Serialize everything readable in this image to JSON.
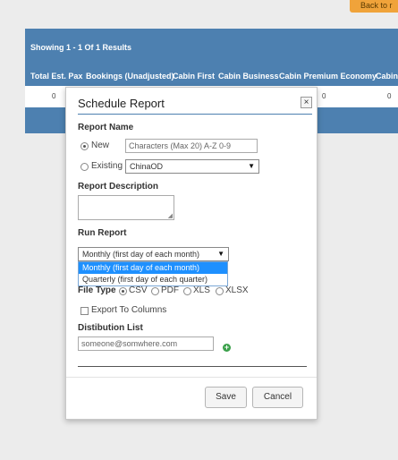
{
  "top_button": {
    "label": "Back to r"
  },
  "grid": {
    "summary": "Showing 1 - 1 Of 1 Results",
    "columns": [
      "Total Est. Pax",
      "Bookings (Unadjusted)",
      "Cabin First",
      "Cabin Business",
      "Cabin Premium Economy",
      "Cabin"
    ],
    "row": [
      "0",
      "0",
      "0"
    ],
    "header_color": "#4d80b0"
  },
  "modal": {
    "title": "Schedule Report",
    "close_icon": "close-icon",
    "report_name": {
      "label": "Report Name",
      "new_label": "New",
      "new_placeholder": "Characters (Max 20) A-Z 0-9",
      "existing_label": "Existing",
      "existing_value": "ChinaOD",
      "selected": "New"
    },
    "report_description": {
      "label": "Report Description",
      "value": ""
    },
    "run_report": {
      "label": "Run Report",
      "selected": "Monthly (first day of each month)",
      "options": [
        "Monthly (first day of each month)",
        "Quarterly (first day of each quarter)"
      ]
    },
    "file_type": {
      "label": "File Type",
      "options": [
        "CSV",
        "PDF",
        "XLS",
        "XLSX"
      ],
      "selected": "CSV"
    },
    "export_to_columns": {
      "label": "Export To Columns",
      "checked": false
    },
    "distribution_list": {
      "label": "Distibution List",
      "placeholder": "someone@somwhere.com",
      "add_icon": "plus-circle-icon"
    },
    "buttons": {
      "save": "Save",
      "cancel": "Cancel"
    },
    "accent_color": "#4d80b0",
    "dropdown_highlight": "#1e90ff"
  }
}
